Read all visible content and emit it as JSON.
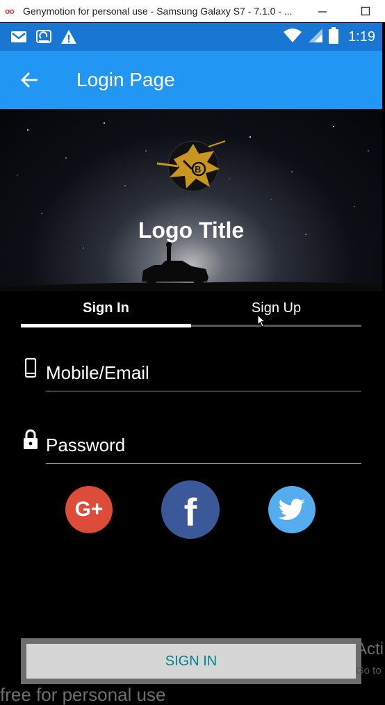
{
  "window": {
    "title": "Genymotion for personal use - Samsung Galaxy S7 - 7.1.0 - ...",
    "logo": "oo",
    "minimize_label": "—",
    "maximize_label": "☐"
  },
  "statusbar": {
    "time": "1:19",
    "icons": [
      "gmail-icon",
      "sync-icon",
      "warning-icon",
      "wifi-icon",
      "signal-icon",
      "battery-icon"
    ]
  },
  "appbar": {
    "title": "Login Page"
  },
  "hero": {
    "logo_title": "Logo Title"
  },
  "tabs": [
    {
      "label": "Sign In",
      "active": true
    },
    {
      "label": "Sign Up",
      "active": false
    }
  ],
  "fields": {
    "mobile_placeholder": "Mobile/Email",
    "password_placeholder": "Password"
  },
  "social": {
    "google": {
      "label": "G+",
      "color": "#dd4b39"
    },
    "facebook": {
      "label": "f",
      "color": "#3b5998"
    },
    "twitter": {
      "color": "#55acee"
    }
  },
  "signin_button": "SIGN IN",
  "colors": {
    "appbar": "#2196f3",
    "statusbar": "#1976d2",
    "button_text": "#00838f"
  },
  "watermark": {
    "activate": "Acti",
    "goto": "Go to",
    "free": "free for personal use"
  }
}
